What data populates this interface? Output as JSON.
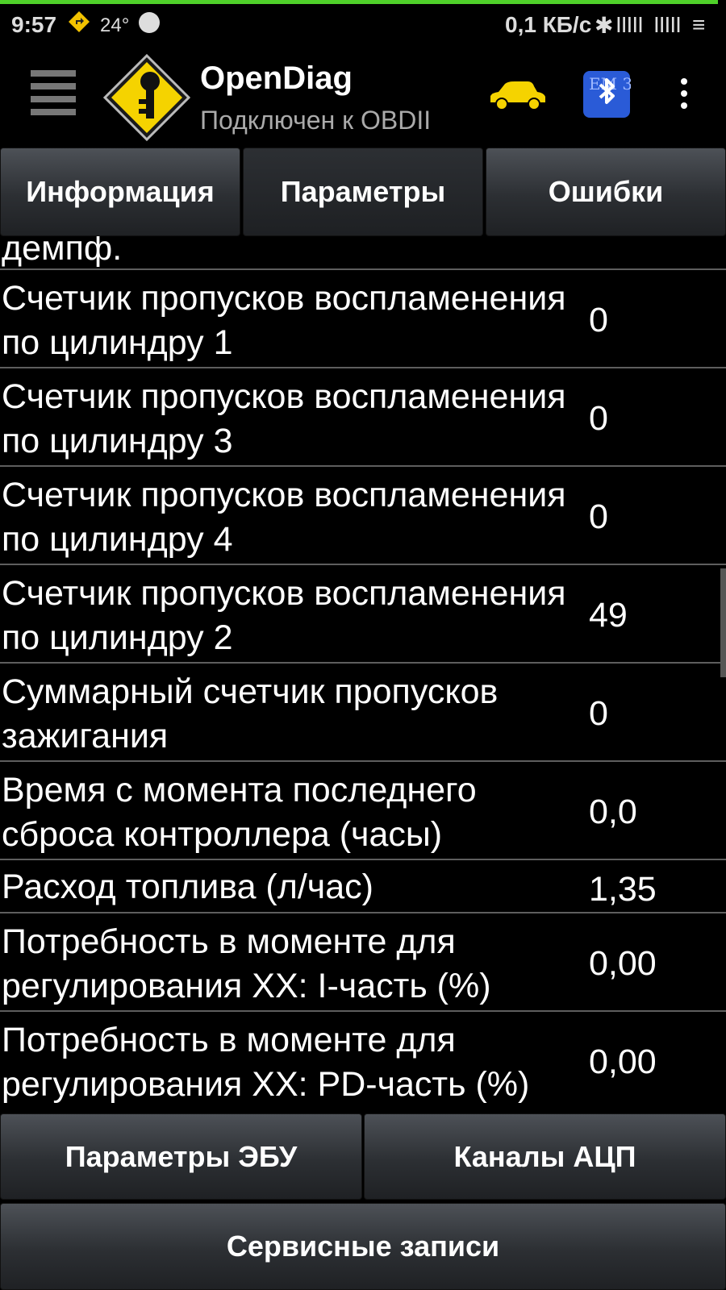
{
  "status_bar": {
    "time": "9:57",
    "temperature": "24°",
    "net_speed": "0,1 КБ/с",
    "bluetooth_glyph": "✱",
    "signal1": "IIIII",
    "signal2": "IIIII",
    "notification_glyph": "≡"
  },
  "app": {
    "title": "OpenDiag",
    "subtitle": "Подключен к OBDII",
    "accent_color": "#f5d300",
    "bt_badge_text": "EM 327"
  },
  "tabs": [
    {
      "label": "Информация",
      "active": false
    },
    {
      "label": "Параметры",
      "active": true
    },
    {
      "label": "Ошибки",
      "active": false
    }
  ],
  "partial_row": {
    "label": "демпф."
  },
  "rows": [
    {
      "label": "Счетчик пропусков воспламенения по цилиндру 1",
      "value": "0"
    },
    {
      "label": "Счетчик пропусков воспламенения по цилиндру 3",
      "value": "0"
    },
    {
      "label": "Счетчик пропусков воспламенения по цилиндру 4",
      "value": "0"
    },
    {
      "label": "Счетчик пропусков воспламенения по цилиндру 2",
      "value": "49"
    },
    {
      "label": "Суммарный счетчик пропусков зажигания",
      "value": "0"
    },
    {
      "label": "Время с момента последнего сброса контроллера (часы)",
      "value": "0,0"
    },
    {
      "label": "Расход топлива (л/час)",
      "value": "1,35"
    },
    {
      "label": "Потребность в моменте для регулирования ХХ: I-часть (%)",
      "value": "0,00"
    },
    {
      "label": "Потребность в моменте для регулирования ХХ: PD-часть (%)",
      "value": "0,00"
    }
  ],
  "buttons": {
    "ecu_params": "Параметры ЭБУ",
    "adc_channels": "Каналы АЦП",
    "service_records": "Сервисные записи"
  }
}
